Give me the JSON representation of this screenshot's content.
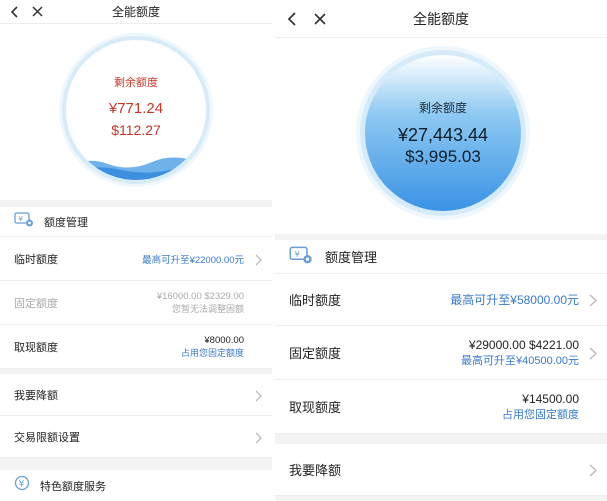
{
  "left": {
    "nav": {
      "title": "全能额度"
    },
    "circle": {
      "label": "剩余额度",
      "amount_primary": "¥771.24",
      "amount_secondary": "$112.27"
    },
    "quota_section": {
      "title": "额度管理",
      "rows": [
        {
          "label": "临时额度",
          "value": "最高可升至¥22000.00元"
        },
        {
          "label": "固定额度",
          "value": "¥16000.00 $2329.00",
          "sub": "您暂无法调整固额"
        },
        {
          "label": "取现额度",
          "value": "¥8000.00",
          "sub": "占用您固定额度"
        }
      ]
    },
    "actions": [
      {
        "label": "我要降额"
      },
      {
        "label": "交易限额设置"
      }
    ],
    "special": {
      "title": "特色额度服务"
    }
  },
  "right": {
    "nav": {
      "title": "全能额度"
    },
    "circle": {
      "label": "剩余额度",
      "amount_primary": "¥27,443.44",
      "amount_secondary": "$3,995.03"
    },
    "quota_section": {
      "title": "额度管理",
      "rows": [
        {
          "label": "临时额度",
          "value": "最高可升至¥58000.00元"
        },
        {
          "label": "固定额度",
          "value": "¥29000.00 $4221.00",
          "sub": "最高可升至¥40500.00元"
        },
        {
          "label": "取现额度",
          "value": "¥14500.00",
          "sub": "占用您固定额度"
        }
      ]
    },
    "actions": [
      {
        "label": "我要降额"
      }
    ]
  },
  "colors": {
    "link_blue": "#3a7ac8",
    "alert_red": "#c0392b",
    "circle_blue": "#3a93e4"
  }
}
